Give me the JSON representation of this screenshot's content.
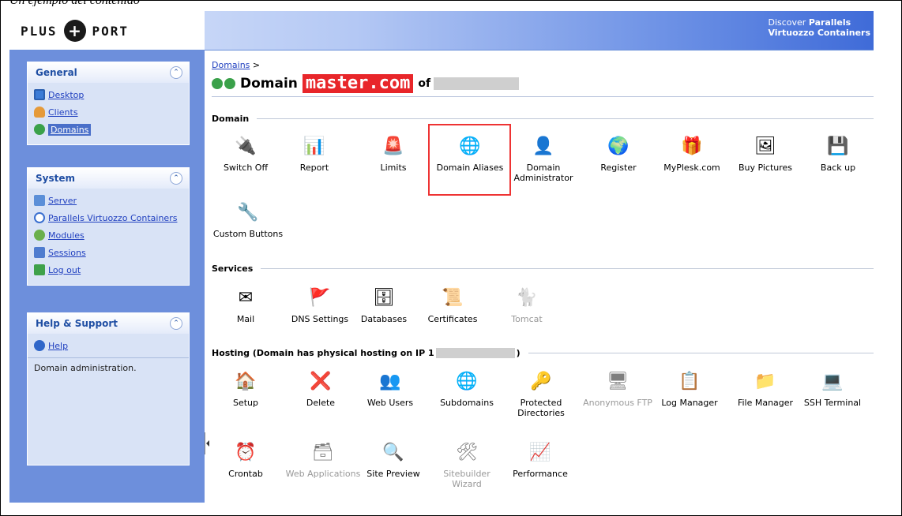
{
  "caption": "Un ejemplo del contenido",
  "header": {
    "logo_left": "PLUS",
    "logo_symbol": "+",
    "logo_right": "PORT",
    "promo_line1": "Discover",
    "promo_brand": "Parallels",
    "promo_line2": "Virtuozzo Containers"
  },
  "sidebar": {
    "general": {
      "title": "General",
      "items": [
        {
          "label": "Desktop",
          "icon": "desktop-icon"
        },
        {
          "label": "Clients",
          "icon": "clients-icon"
        },
        {
          "label": "Domains",
          "icon": "domains-icon",
          "active": true
        }
      ]
    },
    "system": {
      "title": "System",
      "items": [
        {
          "label": "Server",
          "icon": "server-icon"
        },
        {
          "label": "Parallels Virtuozzo Containers",
          "icon": "parallels-icon"
        },
        {
          "label": "Modules",
          "icon": "modules-icon"
        },
        {
          "label": "Sessions",
          "icon": "sessions-icon"
        },
        {
          "label": "Log out",
          "icon": "logout-icon"
        }
      ]
    },
    "help": {
      "title": "Help & Support",
      "items": [
        {
          "label": "Help",
          "icon": "help-icon"
        }
      ],
      "description": "Domain administration."
    }
  },
  "main": {
    "breadcrumb": "Domains",
    "breadcrumb_sep": ">",
    "title_prefix": "Domain",
    "domain_name": "master.com",
    "title_of": "of",
    "sections": {
      "domain": "Domain",
      "services": "Services",
      "hosting": "Hosting (Domain has physical hosting on IP 1",
      "hosting_suffix": ")"
    },
    "domain_tools": [
      {
        "label": "Switch Off",
        "icon": "switch-off-icon"
      },
      {
        "label": "Report",
        "icon": "report-icon"
      },
      {
        "label": "Limits",
        "icon": "limits-icon"
      },
      {
        "label": "Domain Aliases",
        "icon": "domain-aliases-icon"
      },
      {
        "label": "Domain Administrator",
        "icon": "domain-administrator-icon"
      },
      {
        "label": "Register",
        "icon": "register-icon"
      },
      {
        "label": "MyPlesk.com",
        "icon": "myplesk-icon"
      },
      {
        "label": "Buy Pictures",
        "icon": "buy-pictures-icon"
      },
      {
        "label": "Back up",
        "icon": "backup-icon"
      },
      {
        "label": "Custom Buttons",
        "icon": "custom-buttons-icon"
      }
    ],
    "service_tools": [
      {
        "label": "Mail",
        "icon": "mail-icon"
      },
      {
        "label": "DNS Settings",
        "icon": "dns-icon"
      },
      {
        "label": "Databases",
        "icon": "databases-icon"
      },
      {
        "label": "Certificates",
        "icon": "certificates-icon"
      },
      {
        "label": "Tomcat",
        "icon": "tomcat-icon",
        "disabled": true
      }
    ],
    "hosting_tools": [
      {
        "label": "Setup",
        "icon": "setup-icon"
      },
      {
        "label": "Delete",
        "icon": "delete-icon"
      },
      {
        "label": "Web Users",
        "icon": "web-users-icon"
      },
      {
        "label": "Subdomains",
        "icon": "subdomains-icon"
      },
      {
        "label": "Protected Directories",
        "icon": "protected-directories-icon"
      },
      {
        "label": "Anonymous FTP",
        "icon": "anonymous-ftp-icon",
        "disabled": true
      },
      {
        "label": "Log Manager",
        "icon": "log-manager-icon"
      },
      {
        "label": "File Manager",
        "icon": "file-manager-icon"
      },
      {
        "label": "SSH Terminal",
        "icon": "ssh-terminal-icon"
      },
      {
        "label": "Crontab",
        "icon": "crontab-icon"
      },
      {
        "label": "Web Applications",
        "icon": "web-applications-icon",
        "disabled": true
      },
      {
        "label": "Site Preview",
        "icon": "site-preview-icon"
      },
      {
        "label": "Sitebuilder Wizard",
        "icon": "sitebuilder-wizard-icon",
        "disabled": true
      },
      {
        "label": "Performance",
        "icon": "performance-icon"
      }
    ]
  }
}
